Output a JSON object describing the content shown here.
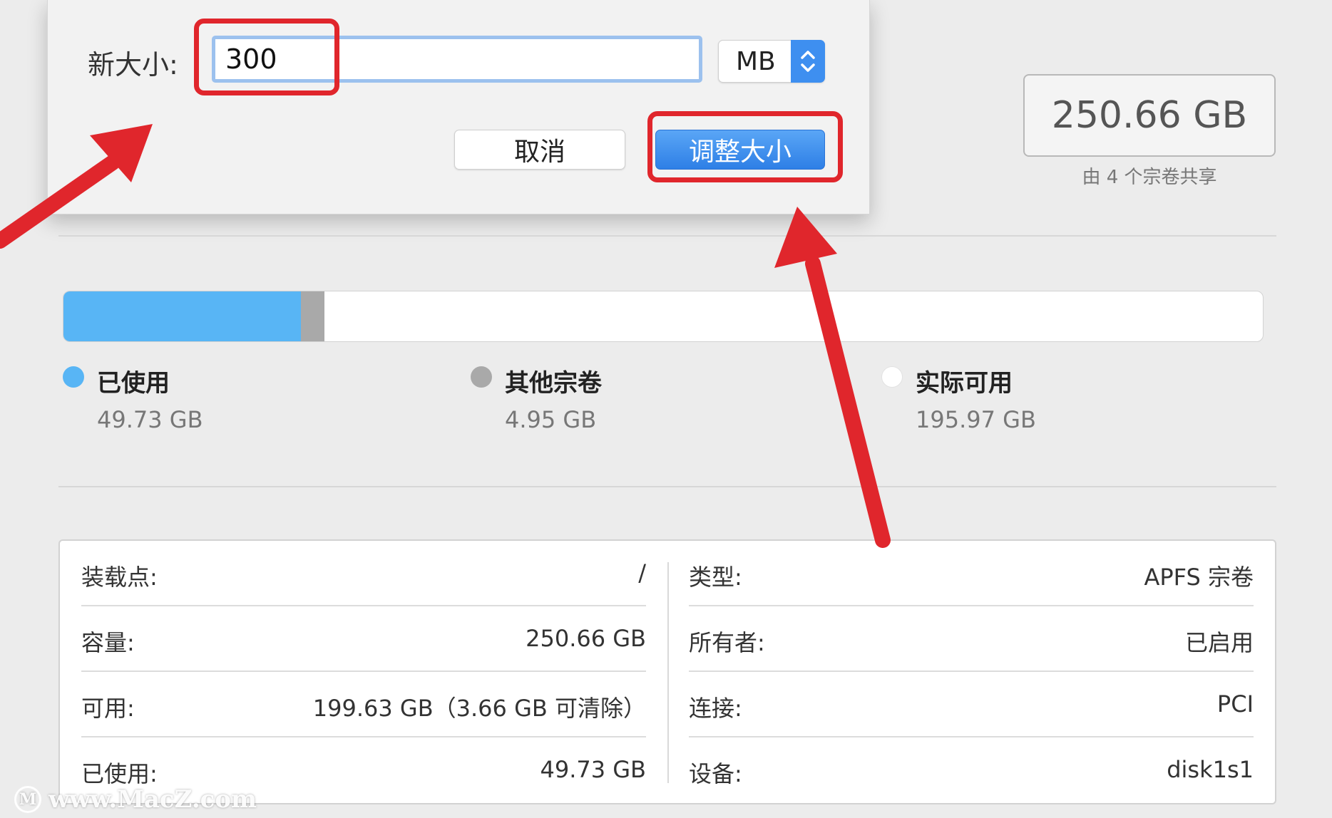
{
  "resize_sheet": {
    "size_label": "新大小:",
    "size_value": "300",
    "unit": "MB",
    "cancel_label": "取消",
    "resize_label": "调整大小"
  },
  "capacity": {
    "value": "250.66 GB",
    "shared_note": "由 4 个宗卷共享"
  },
  "usage": {
    "segments": [
      {
        "key": "used",
        "label": "已使用",
        "value": "49.73 GB",
        "color": "#58b5f5",
        "fraction": 0.198
      },
      {
        "key": "other",
        "label": "其他宗卷",
        "value": "4.95 GB",
        "color": "#a9a9a9",
        "fraction": 0.0197
      },
      {
        "key": "available",
        "label": "实际可用",
        "value": "195.97 GB",
        "color": "#ffffff",
        "fraction": 0.782
      }
    ]
  },
  "info": {
    "left": [
      {
        "key": "装载点:",
        "value": "/"
      },
      {
        "key": "容量:",
        "value": "250.66 GB"
      },
      {
        "key": "可用:",
        "value": "199.63 GB（3.66 GB 可清除）"
      },
      {
        "key": "已使用:",
        "value": "49.73 GB"
      }
    ],
    "right": [
      {
        "key": "类型:",
        "value": "APFS 宗卷"
      },
      {
        "key": "所有者:",
        "value": "已启用"
      },
      {
        "key": "连接:",
        "value": "PCI"
      },
      {
        "key": "设备:",
        "value": "disk1s1"
      }
    ]
  },
  "annotation_color": "#e0262c",
  "watermark": {
    "logo": "M",
    "text": "www.MacZ.com"
  }
}
